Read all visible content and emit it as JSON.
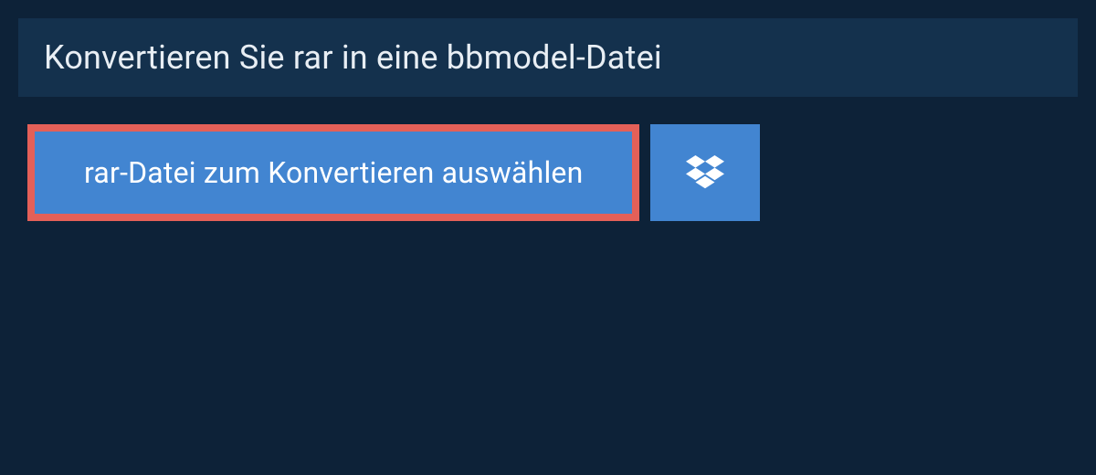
{
  "header": {
    "title": "Konvertieren Sie rar in eine bbmodel-Datei"
  },
  "actions": {
    "select_file_label": "rar-Datei zum Konvertieren auswählen",
    "dropbox_icon_name": "dropbox-icon"
  },
  "colors": {
    "page_bg": "#0d2238",
    "panel_bg": "#14314d",
    "button_bg": "#4285d1",
    "button_border": "#e46058",
    "text_light": "#e8eef4"
  }
}
